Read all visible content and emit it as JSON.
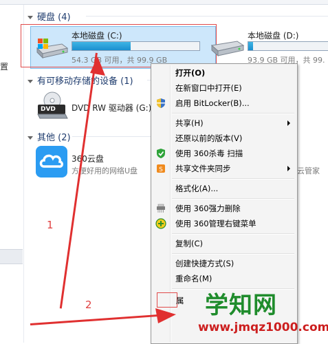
{
  "nav": {
    "partial_label": "置"
  },
  "sections": {
    "hdd": "硬盘 (4)",
    "removable": "有可移动存储的设备 (1)",
    "other": "其他 (2)"
  },
  "drives": [
    {
      "name": "本地磁盘 (C:)",
      "space": "54.3 GB 可用，共 99.9 GB",
      "used_fraction": 0.46
    },
    {
      "name": "本地磁盘 (D:)",
      "space": "93.9 GB 可用，共 99.",
      "used_fraction": 0.06
    }
  ],
  "dvd": {
    "name": "DVD RW 驱动器 (G:)",
    "icon_text": "DVD"
  },
  "cloud": {
    "name": "360云盘",
    "desc": "方便好用的网络U盘",
    "right_fragment": "云管家"
  },
  "menu": {
    "items": [
      {
        "label": "打开(O)",
        "bold": true
      },
      {
        "label": "在新窗口中打开(E)"
      },
      {
        "label": "启用 BitLocker(B)...",
        "icon": "shield-icon"
      },
      {
        "label": "共享(H)",
        "submenu": true
      },
      {
        "label": "还原以前的版本(V)"
      },
      {
        "label": "使用 360杀毒 扫描",
        "icon": "antivirus-icon"
      },
      {
        "label": "共享文件夹同步",
        "submenu": true,
        "icon": "sync-icon"
      },
      {
        "label": "格式化(A)..."
      },
      {
        "label": "使用 360强力删除",
        "icon": "shredder-icon"
      },
      {
        "label": "使用 360管理右键菜单",
        "icon": "plus-icon"
      },
      {
        "label": "复制(C)"
      },
      {
        "label": "创建快捷方式(S)"
      },
      {
        "label": "重命名(M)"
      },
      {
        "label": "属"
      }
    ]
  },
  "annotations": {
    "one": "1",
    "two": "2"
  },
  "watermark": {
    "title": "学知网",
    "url": "www.jmqz1000.com"
  },
  "colors": {
    "accent": "#3fb5e5",
    "red": "#e04040",
    "section": "#1f3c6e"
  }
}
